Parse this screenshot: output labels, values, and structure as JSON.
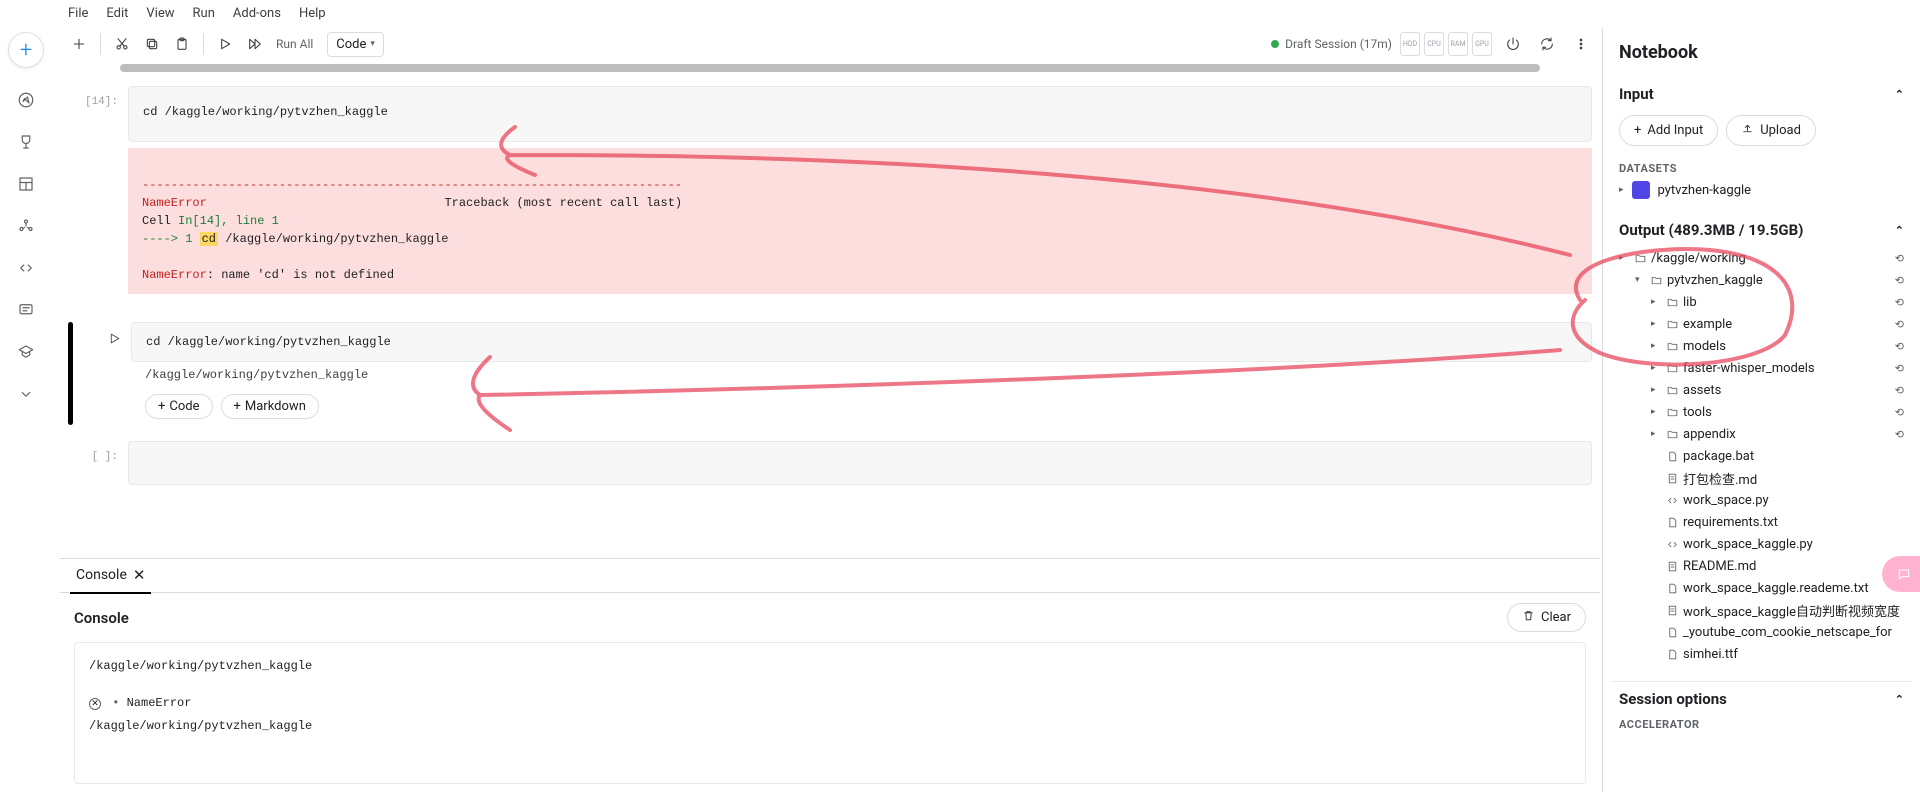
{
  "menu": {
    "file": "File",
    "edit": "Edit",
    "view": "View",
    "run": "Run",
    "addons": "Add-ons",
    "help": "Help"
  },
  "toolbar": {
    "run_all": "Run All",
    "cell_type": "Code"
  },
  "session": {
    "label": "Draft Session (17m)"
  },
  "gauges": [
    "HDD",
    "CPU",
    "RAM",
    "GPU"
  ],
  "cells": {
    "c14_prompt": "[14]:",
    "c14_code": "cd /kaggle/working/pytvzhen_kaggle",
    "c14_err_dashes": "---------------------------------------------------------------------------",
    "c14_err_name": "NameError",
    "c14_err_trace": "Traceback (most recent call last)",
    "c14_err_cell": "Cell ",
    "c14_err_in": "In[14], line 1",
    "c14_err_arrow": "----> 1 ",
    "c14_err_hl": "cd",
    "c14_err_rest": " /kaggle/working/pytvzhen_kaggle",
    "c14_err_final_a": "NameError",
    "c14_err_final_b": ": name 'cd' is not defined",
    "c15_code": "cd /kaggle/working/pytvzhen_kaggle",
    "c15_out": "/kaggle/working/pytvzhen_kaggle",
    "empty_prompt": "[ ]:"
  },
  "add": {
    "code": "Code",
    "markdown": "Markdown"
  },
  "console": {
    "tab": "Console",
    "title": "Console",
    "clear": "Clear",
    "line1": "/kaggle/working/pytvzhen_kaggle",
    "err_label": "NameError",
    "line3": "/kaggle/working/pytvzhen_kaggle"
  },
  "right": {
    "title": "Notebook",
    "input_head": "Input",
    "add_input": "Add Input",
    "upload": "Upload",
    "datasets": "DATASETS",
    "dataset_name": "pytvzhen-kaggle",
    "output_head": "Output (489.3MB / 19.5GB)",
    "session_head": "Session options",
    "accel": "ACCELERATOR",
    "tree": [
      {
        "ind": 0,
        "chev": "▸",
        "type": "folder",
        "name": "/kaggle/working",
        "refresh": true
      },
      {
        "ind": 1,
        "chev": "▾",
        "type": "folder",
        "name": "pytvzhen_kaggle",
        "refresh": true
      },
      {
        "ind": 2,
        "chev": "▸",
        "type": "folder",
        "name": "lib",
        "refresh": true
      },
      {
        "ind": 2,
        "chev": "▸",
        "type": "folder",
        "name": "example",
        "refresh": true
      },
      {
        "ind": 2,
        "chev": "▸",
        "type": "folder",
        "name": "models",
        "refresh": true
      },
      {
        "ind": 2,
        "chev": "▸",
        "type": "folder",
        "name": "faster-whisper_models",
        "refresh": true
      },
      {
        "ind": 2,
        "chev": "▸",
        "type": "folder",
        "name": "assets",
        "refresh": true
      },
      {
        "ind": 2,
        "chev": "▸",
        "type": "folder",
        "name": "tools",
        "refresh": true
      },
      {
        "ind": 2,
        "chev": "▸",
        "type": "folder",
        "name": "appendix",
        "refresh": true
      },
      {
        "ind": 2,
        "chev": "",
        "type": "file",
        "name": "package.bat"
      },
      {
        "ind": 2,
        "chev": "",
        "type": "doc",
        "name": "打包检查.md"
      },
      {
        "ind": 2,
        "chev": "",
        "type": "code",
        "name": "work_space.py"
      },
      {
        "ind": 2,
        "chev": "",
        "type": "file",
        "name": "requirements.txt"
      },
      {
        "ind": 2,
        "chev": "",
        "type": "code",
        "name": "work_space_kaggle.py"
      },
      {
        "ind": 2,
        "chev": "",
        "type": "doc",
        "name": "README.md"
      },
      {
        "ind": 2,
        "chev": "",
        "type": "file",
        "name": "work_space_kaggle.reademe.txt"
      },
      {
        "ind": 2,
        "chev": "",
        "type": "doc",
        "name": "work_space_kaggle自动判断视频宽度"
      },
      {
        "ind": 2,
        "chev": "",
        "type": "file",
        "name": "_youtube_com_cookie_netscape_for"
      },
      {
        "ind": 2,
        "chev": "",
        "type": "file",
        "name": "simhei.ttf"
      }
    ]
  }
}
